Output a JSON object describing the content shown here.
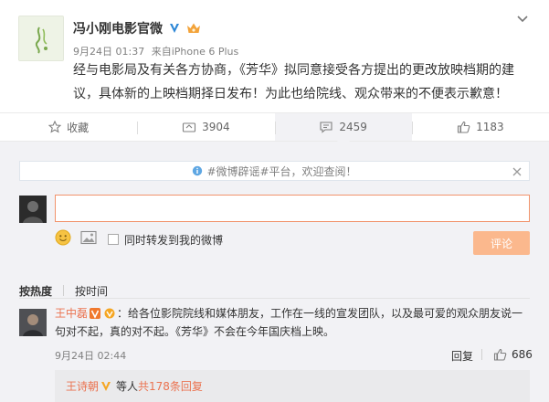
{
  "post": {
    "author": "冯小刚电影官微",
    "timestamp": "9月24日 01:37",
    "source_prefix": "来自",
    "source": "iPhone 6 Plus",
    "content": "经与电影局及有关各方协商，《芳华》拟同意接受各方提出的更改放映档期的建议，具体新的上映档期择日发布！为此也给院线、观众带来的不便表示歉意！"
  },
  "actions": {
    "favorite_label": "收藏",
    "forward_count": "3904",
    "comment_count": "2459",
    "like_count": "1183"
  },
  "notice": {
    "text": "#微博辟谣#平台，欢迎查阅！"
  },
  "compose": {
    "input_value": "",
    "forward_label": "同时转发到我的微博",
    "submit_label": "评论"
  },
  "sort": {
    "hot_label": "按热度",
    "time_label": "按时间"
  },
  "comment": {
    "user": "王中磊",
    "text": "：给各位影院院线和媒体朋友，工作在一线的宣发团队，以及最可爱的观众朋友说一句对不起，真的对不起。《芳华》不会在今年国庆档上映。",
    "time": "9月24日 02:44",
    "reply_label": "回复",
    "like_count": "686"
  },
  "sub_reply": {
    "user": "王诗朝",
    "text": "等人",
    "link": "共178条回复"
  },
  "colors": {
    "accent": "#eb7350",
    "submit_bg": "#fbb88d",
    "input_border": "#f1936c",
    "comment_area_bg": "#f2f2f5"
  },
  "icons": {
    "verified": "verified-v-badge-icon",
    "member": "crown-member-icon",
    "more": "chevron-down-icon",
    "favorite": "star-icon",
    "forward": "forward-icon",
    "comment": "comment-bubble-icon",
    "like": "thumbs-up-icon",
    "info": "info-circle-icon",
    "close": "close-icon",
    "emoji": "emoji-icon",
    "image": "image-icon"
  }
}
